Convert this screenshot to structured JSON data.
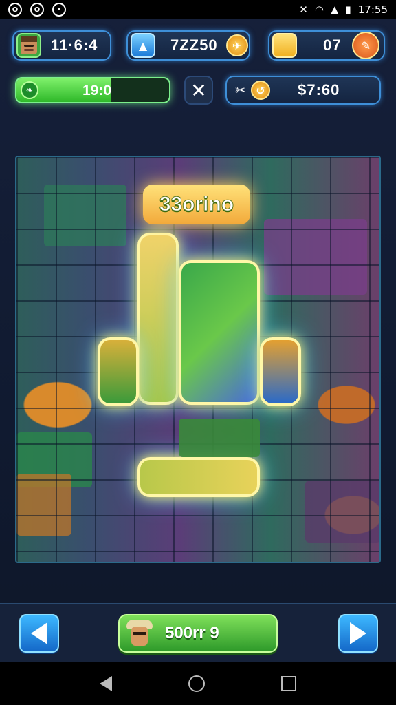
{
  "status_bar": {
    "time": "17:55",
    "left_icons": [
      "app-icon-1",
      "app-icon-2",
      "app-icon-3"
    ],
    "right_icons": [
      "mute-icon",
      "wifi-icon",
      "signal-icon",
      "battery-icon"
    ]
  },
  "hud": {
    "player_score": "11·6:4",
    "gems": "7ZZ50",
    "coins": "07",
    "energy": {
      "value": "19:0",
      "fill_fraction": 0.62
    },
    "bonus": "$7:60"
  },
  "board": {
    "banner_text": "33orino"
  },
  "bottom": {
    "play_label": "500rr 9"
  },
  "colors": {
    "accent_green": "#3db83a",
    "accent_blue": "#1e7fe0",
    "energy_border": "#7cf08c",
    "gold": "#f2a93a"
  }
}
